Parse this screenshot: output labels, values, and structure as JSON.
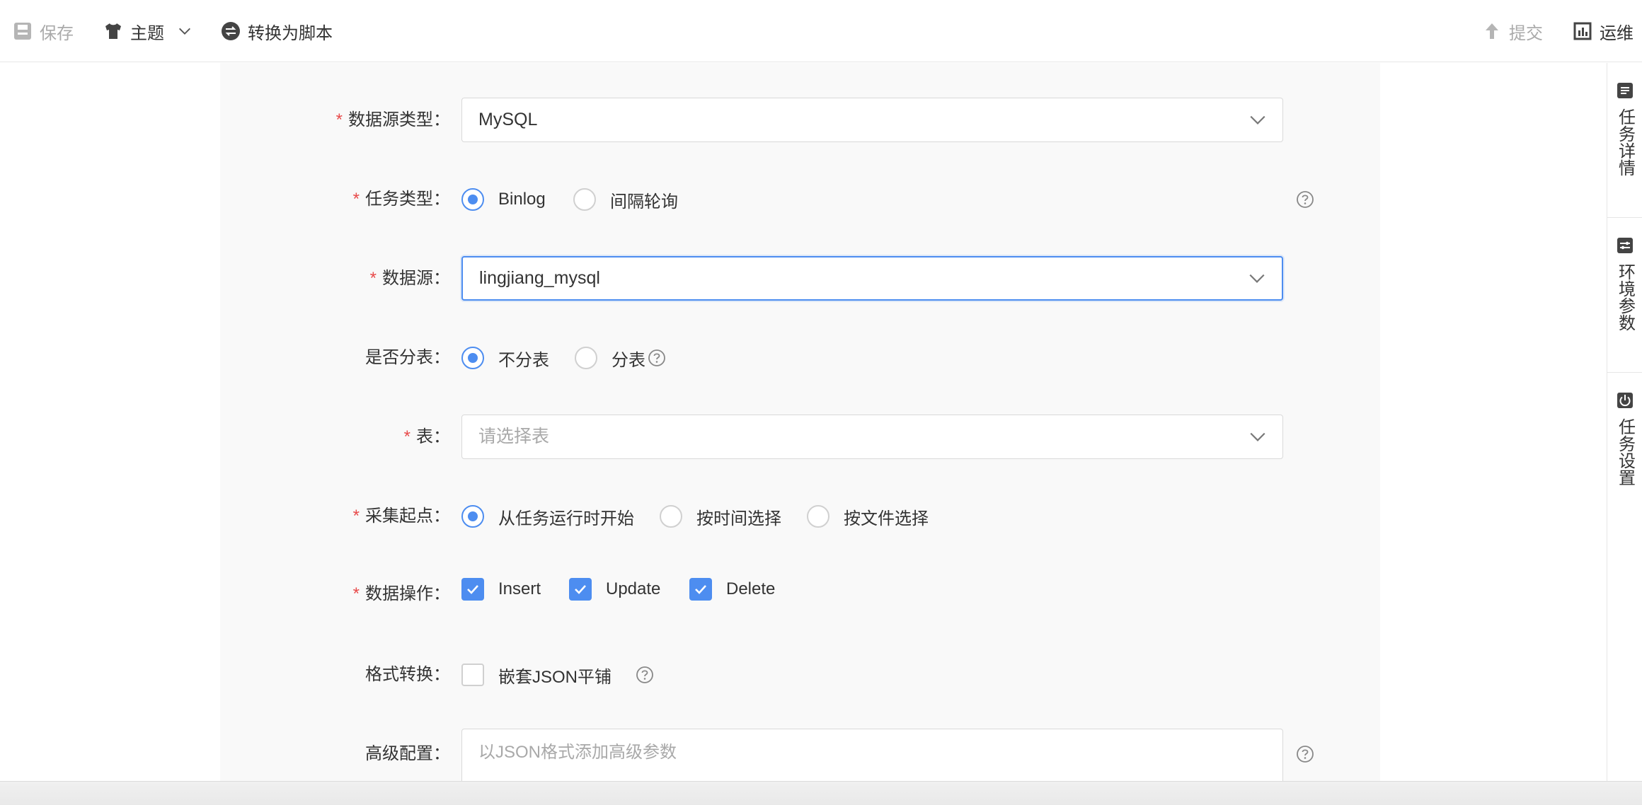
{
  "toolbar": {
    "save": "保存",
    "theme": "主题",
    "convert": "转换为脚本",
    "submit": "提交",
    "ops": "运维"
  },
  "rail": {
    "task_detail": "任务详情",
    "env_params": "环境参数",
    "task_settings": "任务设置"
  },
  "form": {
    "datasource_type": {
      "label": "数据源类型",
      "value": "MySQL"
    },
    "task_type": {
      "label": "任务类型",
      "options": [
        "Binlog",
        "间隔轮询"
      ],
      "selected": "Binlog"
    },
    "datasource": {
      "label": "数据源",
      "value": "lingjiang_mysql"
    },
    "sharding": {
      "label": "是否分表",
      "options": [
        "不分表",
        "分表"
      ],
      "selected": "不分表"
    },
    "table": {
      "label": "表",
      "placeholder": "请选择表"
    },
    "start_point": {
      "label": "采集起点",
      "options": [
        "从任务运行时开始",
        "按时间选择",
        "按文件选择"
      ],
      "selected": "从任务运行时开始"
    },
    "data_ops": {
      "label": "数据操作",
      "options": [
        "Insert",
        "Update",
        "Delete"
      ],
      "checked": [
        "Insert",
        "Update",
        "Delete"
      ]
    },
    "format_conv": {
      "label": "格式转换",
      "option": "嵌套JSON平铺",
      "checked": false
    },
    "advanced": {
      "label": "高级配置",
      "placeholder": "以JSON格式添加高级参数"
    }
  },
  "colors": {
    "accent": "#4d8df0",
    "required": "#e84a4a",
    "panel_bg": "#f9f9f9"
  }
}
